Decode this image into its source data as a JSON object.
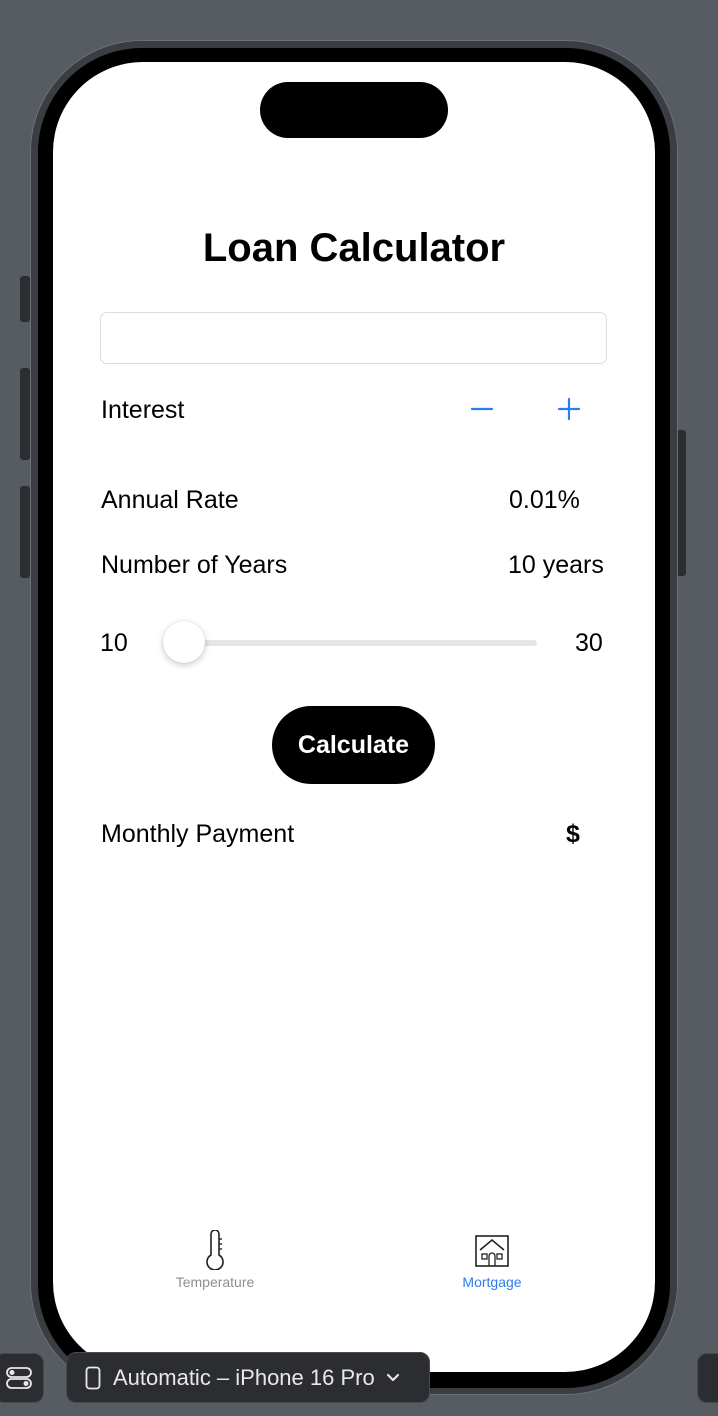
{
  "app": {
    "title": "Loan Calculator",
    "accent_color": "#2f7bf5"
  },
  "loan_input": {
    "value": "",
    "placeholder": ""
  },
  "interest": {
    "label": "Interest",
    "decrement_icon": "minus-icon",
    "increment_icon": "plus-icon"
  },
  "annual_rate": {
    "label": "Annual Rate",
    "value": "0.01%"
  },
  "years": {
    "label": "Number of Years",
    "value": "10 years"
  },
  "slider": {
    "min_label": "10",
    "max_label": "30",
    "current": 10,
    "min": 10,
    "max": 30
  },
  "calculate_button": {
    "label": "Calculate"
  },
  "monthly_payment": {
    "label": "Monthly Payment",
    "value": "$"
  },
  "tabs": [
    {
      "label": "Temperature",
      "icon": "thermometer-icon",
      "selected": false,
      "color": "#8e8e93"
    },
    {
      "label": "Mortgage",
      "icon": "house-icon",
      "selected": true,
      "color": "#2f7bf5"
    }
  ],
  "toolbar": {
    "device_selector_label": "Automatic – iPhone 16 Pro",
    "left_icon": "toggle-icon",
    "device_icon": "phone-icon",
    "dropdown_icon": "chevron-down-icon"
  }
}
